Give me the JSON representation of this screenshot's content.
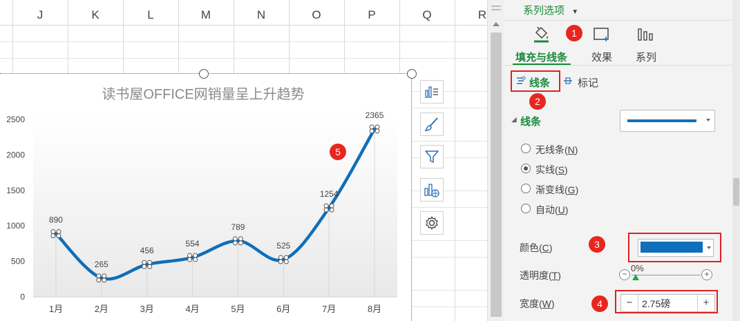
{
  "columns": [
    "J",
    "K",
    "L",
    "M",
    "N",
    "O",
    "P",
    "Q",
    "R"
  ],
  "chart": {
    "title": "读书屋OFFICE网销量呈上升趋势"
  },
  "chart_data": {
    "type": "line",
    "title": "读书屋OFFICE网销量呈上升趋势",
    "categories": [
      "1月",
      "2月",
      "3月",
      "4月",
      "5月",
      "6月",
      "7月",
      "8月"
    ],
    "values": [
      890,
      265,
      456,
      554,
      789,
      525,
      1254,
      2365
    ],
    "yticks": [
      "0",
      "500",
      "1000",
      "1500",
      "2000",
      "2500"
    ],
    "ylim": [
      0,
      2500
    ],
    "smooth": true,
    "line_color": "#0f6fba",
    "grid": false
  },
  "panel": {
    "dropdown_title": "系列选项",
    "tabs": [
      {
        "label": "填充与线条",
        "icon": "paint-bucket-icon"
      },
      {
        "label": "效果",
        "icon": "effects-icon"
      },
      {
        "label": "系列",
        "icon": "series-bars-icon"
      }
    ],
    "subtabs": {
      "line": "线条",
      "marker": "标记"
    },
    "section_title": "线条",
    "radio_none": "无线条",
    "radio_none_key": "N",
    "radio_solid": "实线",
    "radio_solid_key": "S",
    "radio_gradient": "渐变线",
    "radio_gradient_key": "G",
    "radio_auto": "自动",
    "radio_auto_key": "U",
    "color_label": "颜色",
    "color_key": "C",
    "color_value": "#0f6fba",
    "transparency_label": "透明度",
    "transparency_key": "T",
    "transparency_value": "0%",
    "width_label": "宽度",
    "width_key": "W",
    "width_value": "2.75磅",
    "minus": "−",
    "plus": "+"
  },
  "badges": [
    "1",
    "2",
    "3",
    "4",
    "5"
  ]
}
